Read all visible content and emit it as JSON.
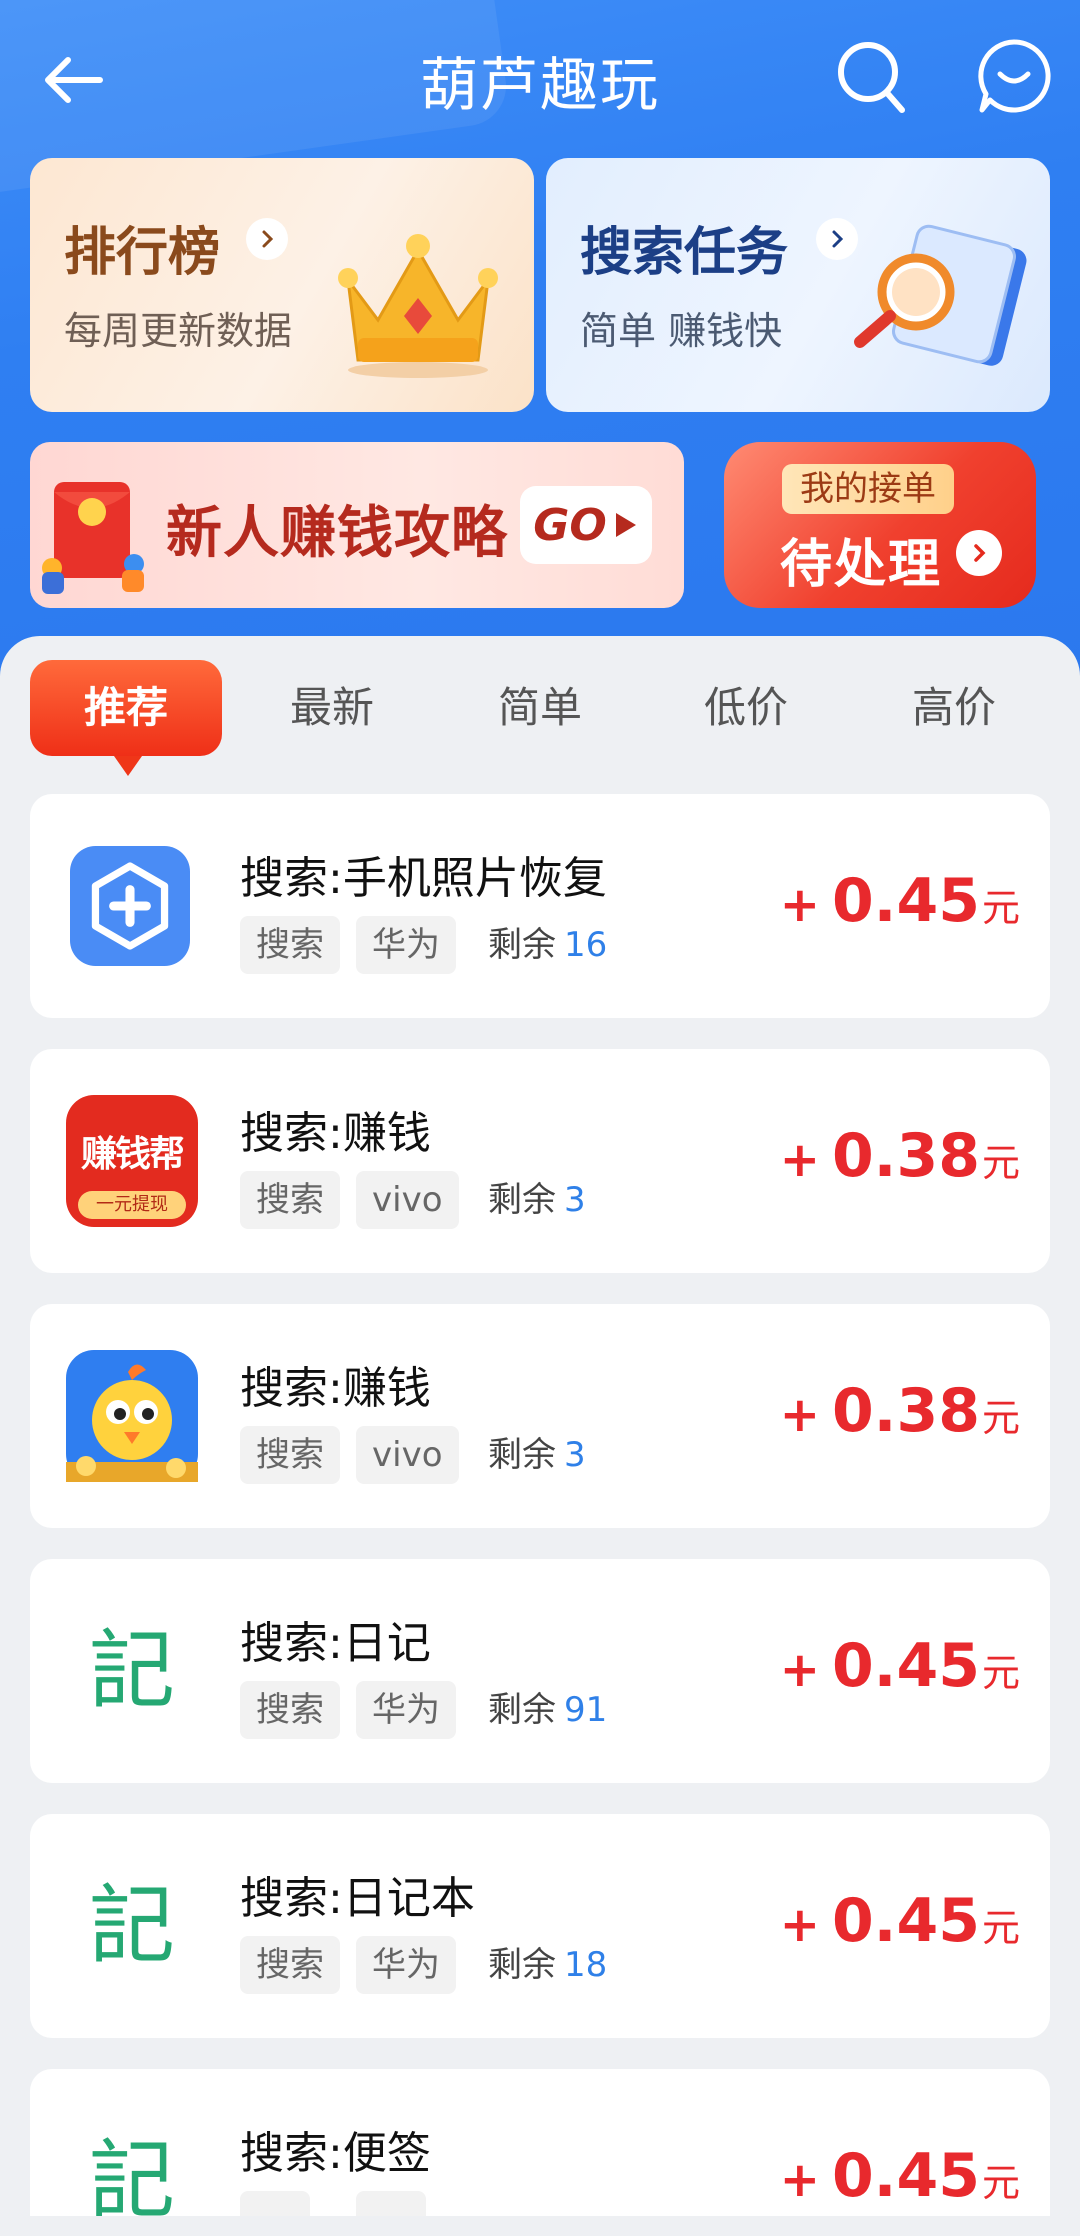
{
  "header": {
    "title": "葫芦趣玩"
  },
  "cards": {
    "rank": {
      "title": "排行榜",
      "subtitle": "每周更新数据"
    },
    "search": {
      "title": "搜索任务",
      "subtitle": "简单 赚钱快"
    }
  },
  "banners": {
    "new_user": {
      "text": "新人赚钱攻略",
      "button": "GO"
    },
    "my_orders": {
      "tag": "我的接单",
      "title": "待处理"
    }
  },
  "tabs": [
    "推荐",
    "最新",
    "简单",
    "低价",
    "高价"
  ],
  "active_tab": "推荐",
  "tasks": [
    {
      "title": "搜索:手机照片恢复",
      "tags": [
        "搜索",
        "华为"
      ],
      "remain_label": "剩余",
      "remain": "16",
      "price_prefix": "+",
      "price": "0.45",
      "unit": "元",
      "icon": "photo-recovery-icon"
    },
    {
      "title": "搜索:赚钱",
      "tags": [
        "搜索",
        "vivo"
      ],
      "remain_label": "剩余",
      "remain": "3",
      "price_prefix": "+",
      "price": "0.38",
      "unit": "元",
      "icon": "zhuanqianbang-app-icon",
      "icon_text": "赚钱帮",
      "icon_subtext": "一元提现"
    },
    {
      "title": "搜索:赚钱",
      "tags": [
        "搜索",
        "vivo"
      ],
      "remain_label": "剩余",
      "remain": "3",
      "price_prefix": "+",
      "price": "0.38",
      "unit": "元",
      "icon": "chick-game-icon"
    },
    {
      "title": "搜索:日记",
      "tags": [
        "搜索",
        "华为"
      ],
      "remain_label": "剩余",
      "remain": "91",
      "price_prefix": "+",
      "price": "0.45",
      "unit": "元",
      "icon": "diary-icon",
      "icon_text": "記"
    },
    {
      "title": "搜索:日记本",
      "tags": [
        "搜索",
        "华为"
      ],
      "remain_label": "剩余",
      "remain": "18",
      "price_prefix": "+",
      "price": "0.45",
      "unit": "元",
      "icon": "diary-icon",
      "icon_text": "記"
    },
    {
      "title": "搜索:便签",
      "tags": [],
      "remain_label": "",
      "remain": "",
      "price_prefix": "+",
      "price": "0.45",
      "unit": "元",
      "icon": "diary-icon",
      "icon_text": "記"
    }
  ],
  "colors": {
    "primary_blue": "#2f7ff2",
    "price_red": "#e8292d",
    "remain_blue": "#2f80e8",
    "tab_active": "#ef2f17"
  }
}
